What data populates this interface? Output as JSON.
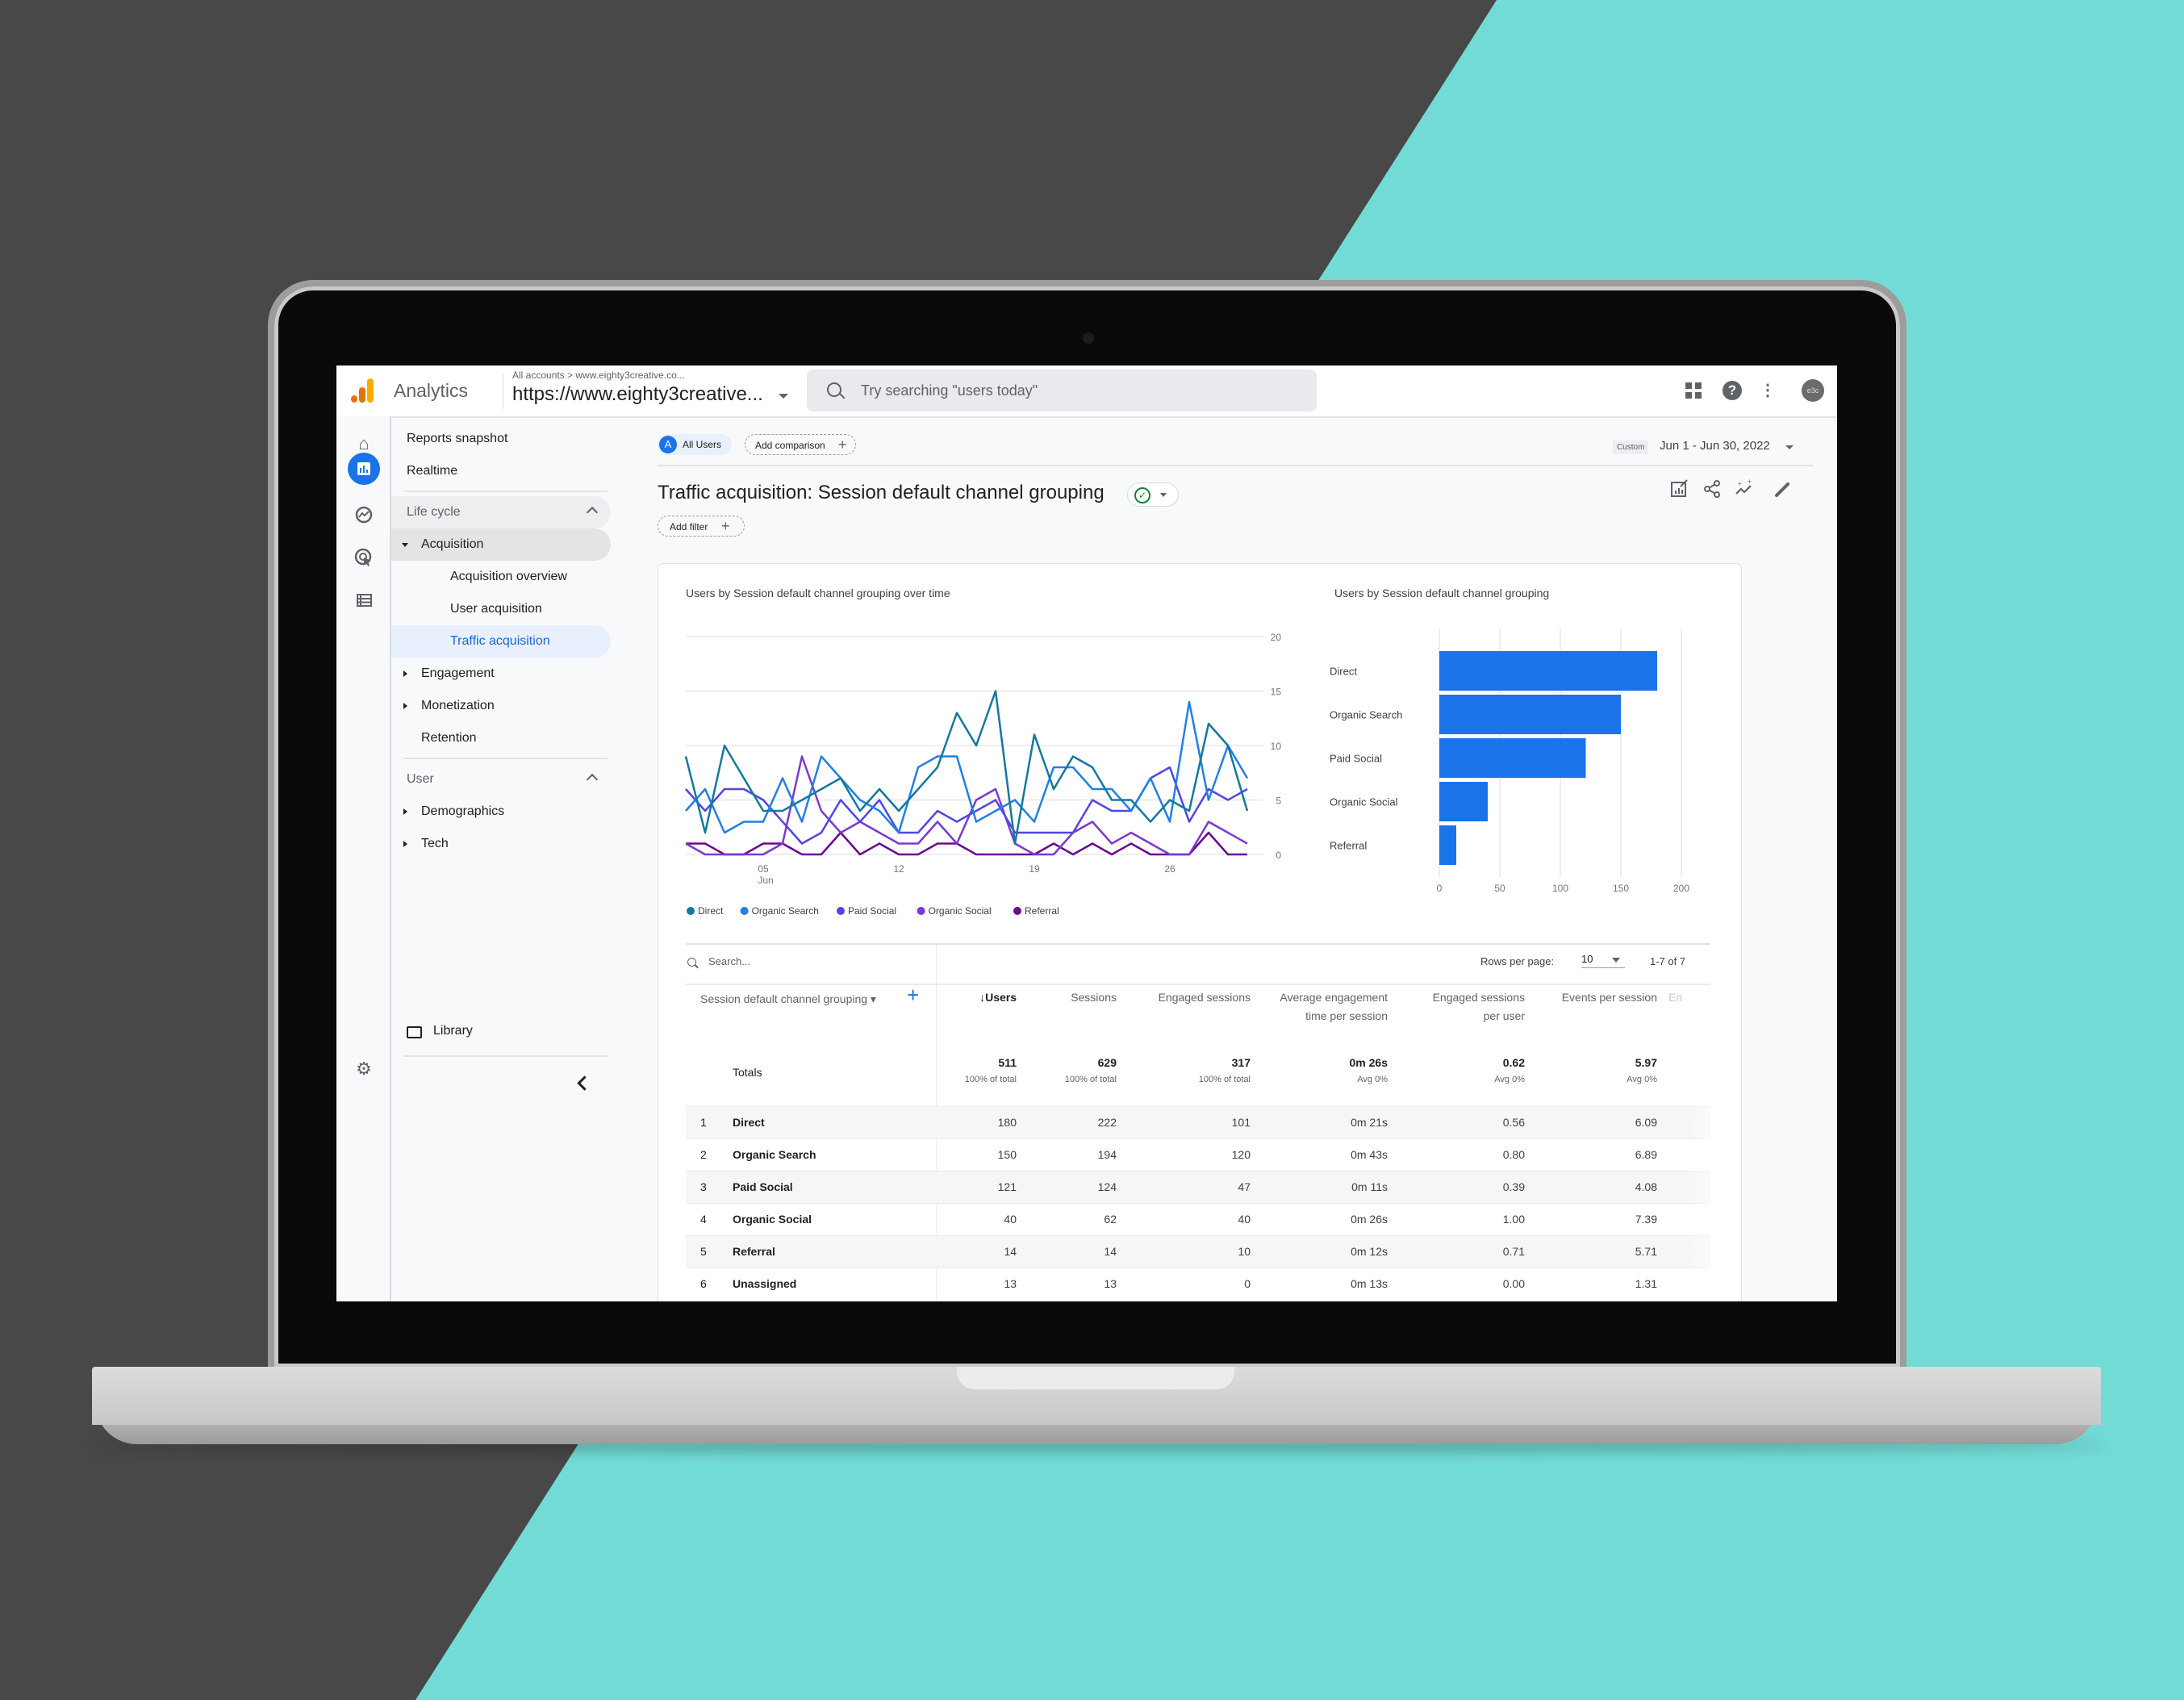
{
  "app": {
    "product_name": "Analytics",
    "breadcrumb": "All accounts > www.eighty3creative.co...",
    "property": "https://www.eighty3creative...",
    "search_placeholder": "Try searching \"users today\"",
    "avatar_initials": "e3c",
    "topbar_icons": [
      "apps-grid-icon",
      "help-icon",
      "more-vert-icon"
    ]
  },
  "rail": {
    "icons": [
      "home-icon",
      "reports-icon",
      "explore-icon",
      "advertising-icon",
      "configure-icon",
      "settings-icon"
    ],
    "active": "reports-icon"
  },
  "nav": {
    "items": [
      {
        "label": "Reports snapshot",
        "kind": "top"
      },
      {
        "label": "Realtime",
        "kind": "top"
      },
      {
        "label": "Life cycle",
        "kind": "section"
      },
      {
        "label": "Acquisition",
        "kind": "parent-open"
      },
      {
        "label": "Acquisition overview",
        "kind": "sub"
      },
      {
        "label": "User acquisition",
        "kind": "sub"
      },
      {
        "label": "Traffic acquisition",
        "kind": "sub-selected"
      },
      {
        "label": "Engagement",
        "kind": "parent"
      },
      {
        "label": "Monetization",
        "kind": "parent"
      },
      {
        "label": "Retention",
        "kind": "leaf"
      },
      {
        "label": "User",
        "kind": "section"
      },
      {
        "label": "Demographics",
        "kind": "parent"
      },
      {
        "label": "Tech",
        "kind": "parent"
      }
    ],
    "library_label": "Library"
  },
  "header": {
    "segment_badge": "A",
    "segment_label": "All Users",
    "add_comparison": "Add comparison",
    "date_preset": "Custom",
    "date_range": "Jun 1 - Jun 30, 2022",
    "title": "Traffic acquisition: Session default channel grouping",
    "add_filter": "Add filter",
    "status_icon": "check-circle-icon",
    "actions": [
      "customize-report-icon",
      "share-icon",
      "insights-icon",
      "edit-icon"
    ]
  },
  "colors": {
    "accent": "#1a73e8",
    "Direct": "#12799c",
    "Organic Search": "#2080e5",
    "Paid Social": "#5046e5",
    "Organic Social": "#7a3ad0",
    "Referral": "#6a0a8c",
    "bar": "#1a73e8"
  },
  "chart_data": [
    {
      "type": "line",
      "title": "Users by Session default channel grouping over time",
      "x": [
        1,
        2,
        3,
        4,
        5,
        6,
        7,
        8,
        9,
        10,
        11,
        12,
        13,
        14,
        15,
        16,
        17,
        18,
        19,
        20,
        21,
        22,
        23,
        24,
        25,
        26,
        27,
        28,
        29,
        30
      ],
      "x_ticks": [
        {
          "day": 5,
          "label": "05",
          "sub": "Jun"
        },
        {
          "day": 12,
          "label": "12"
        },
        {
          "day": 19,
          "label": "19"
        },
        {
          "day": 26,
          "label": "26"
        }
      ],
      "ylim": [
        0,
        20
      ],
      "y_ticks": [
        0,
        5,
        10,
        15,
        20
      ],
      "y_axis_side": "right",
      "grid": true,
      "legend_position": "bottom-left",
      "series": [
        {
          "name": "Direct",
          "values": [
            9,
            2,
            10,
            7,
            4,
            4,
            5,
            6,
            7,
            4,
            6,
            4,
            6,
            8,
            13,
            10,
            15,
            1,
            11,
            6,
            9,
            8,
            5,
            5,
            3,
            5,
            4,
            12,
            10,
            4
          ]
        },
        {
          "name": "Organic Search",
          "values": [
            4,
            6,
            2,
            3,
            3,
            7,
            3,
            9,
            7,
            5,
            4,
            2,
            8,
            9,
            9,
            3,
            4,
            5,
            3,
            8,
            8,
            6,
            6,
            4,
            7,
            3,
            14,
            5,
            10,
            7
          ]
        },
        {
          "name": "Paid Social",
          "values": [
            6,
            4,
            6,
            6,
            5,
            3,
            1,
            2,
            5,
            3,
            5,
            2,
            2,
            4,
            3,
            4,
            5,
            2,
            2,
            2,
            2,
            5,
            4,
            4,
            7,
            8,
            3,
            6,
            5,
            6
          ]
        },
        {
          "name": "Organic Social",
          "values": [
            1,
            0,
            0,
            0,
            0,
            1,
            9,
            4,
            2,
            3,
            2,
            1,
            1,
            3,
            1,
            5,
            6,
            1,
            0,
            0,
            2,
            3,
            1,
            2,
            1,
            0,
            0,
            3,
            2,
            1
          ]
        },
        {
          "name": "Referral",
          "values": [
            1,
            1,
            0,
            0,
            1,
            1,
            0,
            0,
            2,
            0,
            1,
            0,
            0,
            1,
            1,
            0,
            0,
            0,
            0,
            1,
            0,
            1,
            0,
            1,
            0,
            0,
            0,
            2,
            0,
            0
          ]
        }
      ]
    },
    {
      "type": "bar",
      "orientation": "horizontal",
      "title": "Users by Session default channel grouping",
      "categories": [
        "Direct",
        "Organic Search",
        "Paid Social",
        "Organic Social",
        "Referral"
      ],
      "values": [
        180,
        150,
        121,
        40,
        14
      ],
      "xlim": [
        0,
        200
      ],
      "x_ticks": [
        0,
        50,
        100,
        150,
        200
      ],
      "grid": true
    }
  ],
  "table": {
    "search_placeholder": "Search...",
    "rows_per_page_label": "Rows per page:",
    "rows_per_page": "10",
    "pagination": "1-7 of 7",
    "dimension_header": "Session default channel grouping",
    "columns": [
      "↓Users",
      "Sessions",
      "Engaged sessions",
      "Average engagement time per session",
      "Engaged sessions per user",
      "Events per session",
      "En"
    ],
    "totals_label": "Totals",
    "totals": [
      {
        "value": "511",
        "sub": "100% of total"
      },
      {
        "value": "629",
        "sub": "100% of total"
      },
      {
        "value": "317",
        "sub": "100% of total"
      },
      {
        "value": "0m 26s",
        "sub": "Avg 0%"
      },
      {
        "value": "0.62",
        "sub": "Avg 0%"
      },
      {
        "value": "5.97",
        "sub": "Avg 0%"
      }
    ],
    "rows": [
      {
        "n": "1",
        "dim": "Direct",
        "cells": [
          "180",
          "222",
          "101",
          "0m 21s",
          "0.56",
          "6.09"
        ]
      },
      {
        "n": "2",
        "dim": "Organic Search",
        "cells": [
          "150",
          "194",
          "120",
          "0m 43s",
          "0.80",
          "6.89"
        ]
      },
      {
        "n": "3",
        "dim": "Paid Social",
        "cells": [
          "121",
          "124",
          "47",
          "0m 11s",
          "0.39",
          "4.08"
        ]
      },
      {
        "n": "4",
        "dim": "Organic Social",
        "cells": [
          "40",
          "62",
          "40",
          "0m 26s",
          "1.00",
          "7.39"
        ]
      },
      {
        "n": "5",
        "dim": "Referral",
        "cells": [
          "14",
          "14",
          "10",
          "0m 12s",
          "0.71",
          "5.71"
        ]
      },
      {
        "n": "6",
        "dim": "Unassigned",
        "cells": [
          "13",
          "13",
          "0",
          "0m 13s",
          "0.00",
          "1.31"
        ]
      }
    ]
  }
}
